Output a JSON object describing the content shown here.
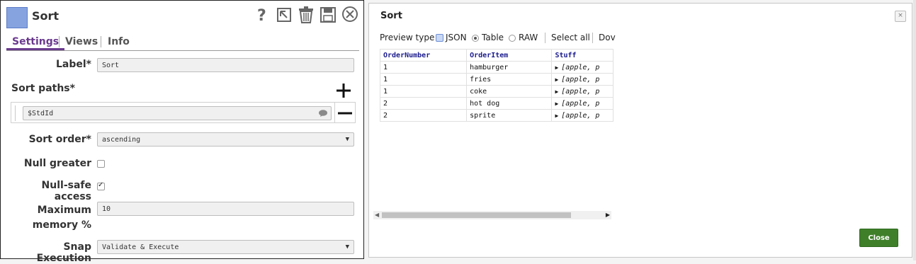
{
  "snap": {
    "title": "Sort",
    "color": "#86a3e0",
    "icons": [
      "help-icon",
      "export-icon",
      "trash-icon",
      "save-icon",
      "close-circle-icon"
    ],
    "tabs": [
      {
        "label": "Settings",
        "active": true
      },
      {
        "label": "Views",
        "active": false
      },
      {
        "label": "Info",
        "active": false
      }
    ],
    "fields": {
      "label": {
        "label": "Label*",
        "value": "Sort"
      },
      "sort_paths": {
        "label": "Sort paths*",
        "value": "$StdId",
        "add": "+",
        "remove": "−"
      },
      "sort_order": {
        "label": "Sort order*",
        "value": "ascending"
      },
      "null_greater": {
        "label": "Null greater",
        "checked": false
      },
      "null_safe": {
        "label": "Null-safe access",
        "checked": true
      },
      "max_memory": {
        "label_line1": "Maximum",
        "label_line2": "memory %",
        "value": "10"
      },
      "snap_execution": {
        "label": "Snap Execution",
        "value": "Validate & Execute"
      }
    }
  },
  "preview": {
    "title": "Sort",
    "close_x": "×",
    "toolbar": {
      "preview_type": "Preview type",
      "json": "JSON",
      "table": "Table",
      "raw": "RAW",
      "selected": "Table",
      "select_all": "Select all",
      "download": "Dov"
    },
    "table": {
      "columns": [
        "OrderNumber",
        "OrderItem",
        "Stuff"
      ],
      "rows": [
        [
          "1",
          "hamburger",
          "[apple, p"
        ],
        [
          "1",
          "fries",
          "[apple, p"
        ],
        [
          "1",
          "coke",
          "[apple, p"
        ],
        [
          "2",
          "hot dog",
          "[apple, p"
        ],
        [
          "2",
          "sprite",
          "[apple, p"
        ]
      ]
    },
    "close_button": "Close",
    "close_button_color": "#3f7f2a"
  }
}
